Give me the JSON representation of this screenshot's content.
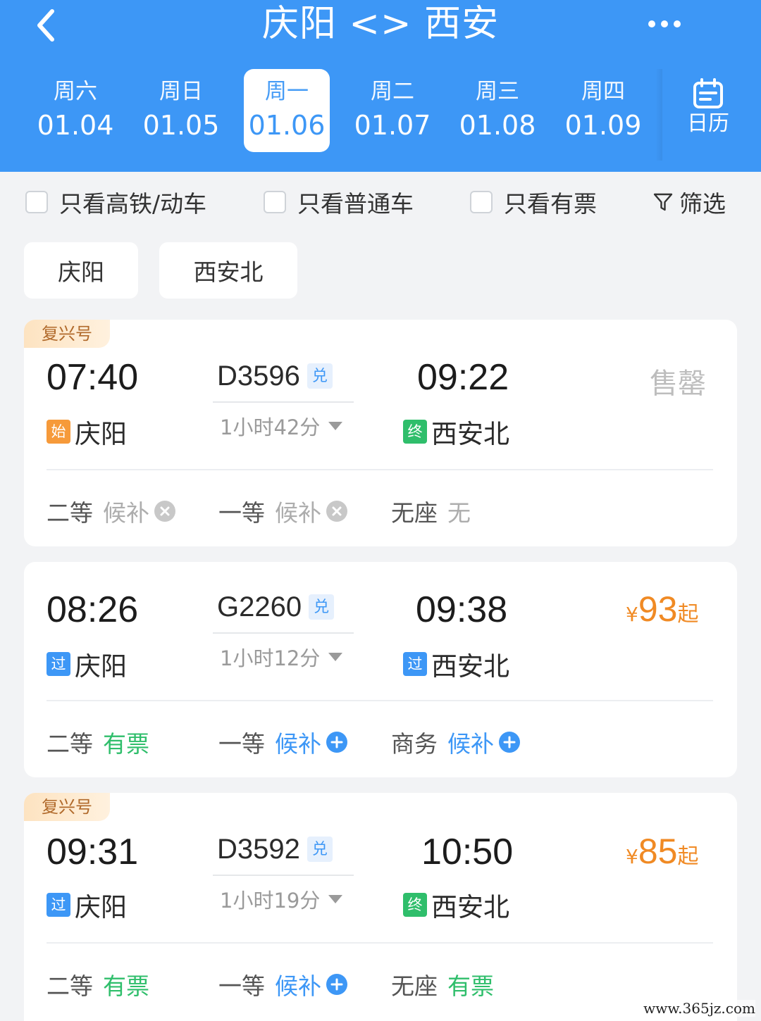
{
  "header": {
    "title": "庆阳 <> 西安",
    "back_icon": "chevron-left-icon",
    "more_icon": "more-horizontal-icon",
    "dates": [
      {
        "weekday": "周六",
        "date": "01.04"
      },
      {
        "weekday": "周日",
        "date": "01.05"
      },
      {
        "weekday": "周一",
        "date": "01.06",
        "selected": true
      },
      {
        "weekday": "周二",
        "date": "01.07"
      },
      {
        "weekday": "周三",
        "date": "01.08"
      },
      {
        "weekday": "周四",
        "date": "01.09"
      }
    ],
    "calendar_label": "日历",
    "calendar_icon": "calendar-icon"
  },
  "filters": {
    "high_speed": "只看高铁/动车",
    "normal": "只看普通车",
    "available": "只看有票",
    "screen": "筛选",
    "screen_icon": "filter-icon"
  },
  "stations": [
    "庆阳",
    "西安北"
  ],
  "trains": [
    {
      "badge": "复兴号",
      "depart_time": "07:40",
      "depart_tag": "始",
      "depart_station": "庆阳",
      "train_no": "D3596",
      "exchange_tag": "兑",
      "duration": "1小时42分",
      "arrive_time": "09:22",
      "arrive_tag": "终",
      "arrive_station": "西安北",
      "status": "售罄",
      "seats": [
        {
          "class": "二等",
          "status": "候补"
        },
        {
          "class": "一等",
          "status": "候补"
        },
        {
          "class": "无座",
          "status": "无"
        }
      ]
    },
    {
      "badge": "",
      "depart_time": "08:26",
      "depart_tag": "过",
      "depart_station": "庆阳",
      "train_no": "G2260",
      "exchange_tag": "兑",
      "duration": "1小时12分",
      "arrive_time": "09:38",
      "arrive_tag": "过",
      "arrive_station": "西安北",
      "price_currency": "¥",
      "price_value": "93",
      "price_suffix": "起",
      "seats": [
        {
          "class": "二等",
          "status": "有票"
        },
        {
          "class": "一等",
          "status": "候补"
        },
        {
          "class": "商务",
          "status": "候补"
        }
      ]
    },
    {
      "badge": "复兴号",
      "depart_time": "09:31",
      "depart_tag": "过",
      "depart_station": "庆阳",
      "train_no": "D3592",
      "exchange_tag": "兑",
      "duration": "1小时19分",
      "arrive_time": "10:50",
      "arrive_tag": "终",
      "arrive_station": "西安北",
      "price_currency": "¥",
      "price_value": "85",
      "price_suffix": "起",
      "seats": [
        {
          "class": "二等",
          "status": "有票"
        },
        {
          "class": "一等",
          "status": "候补"
        },
        {
          "class": "无座",
          "status": "有票"
        }
      ]
    }
  ],
  "colors": {
    "primary": "#3d97f6",
    "price": "#f08a24",
    "available": "#2fbe6b",
    "disabled": "#adadad"
  },
  "watermark": "www.365jz.com"
}
